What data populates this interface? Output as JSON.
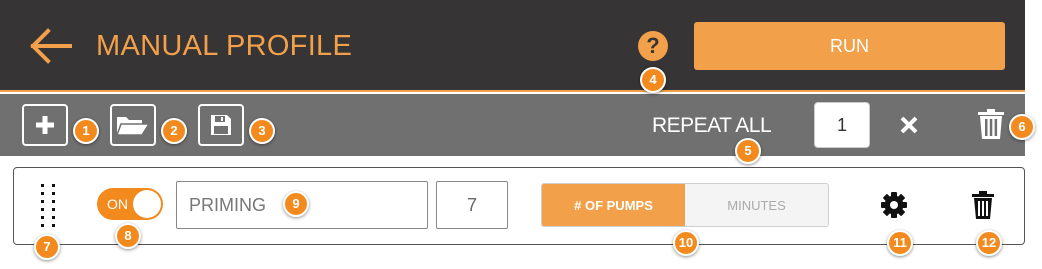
{
  "header": {
    "title": "MANUAL PROFILE",
    "help_label": "?",
    "run_label": "RUN"
  },
  "toolbar": {
    "repeat_label": "REPEAT ALL",
    "repeat_value": "1"
  },
  "row": {
    "toggle_label": "ON",
    "toggle_on": true,
    "name_value": "PRIMING",
    "count_value": "7",
    "segments": [
      "# OF PUMPS",
      "MINUTES"
    ],
    "selected_segment": "# OF PUMPS"
  },
  "callouts": [
    "1",
    "2",
    "3",
    "4",
    "5",
    "6",
    "7",
    "8",
    "9",
    "10",
    "11",
    "12"
  ],
  "colors": {
    "accent": "#f2a04a",
    "header_bg": "#363434",
    "toolbar_bg": "#707070",
    "badge": "#f28a1e"
  },
  "icons": [
    "back-arrow-icon",
    "help-icon",
    "plus-icon",
    "folder-open-icon",
    "save-icon",
    "close-icon",
    "trash-icon",
    "drag-handle-icon",
    "gear-icon"
  ]
}
